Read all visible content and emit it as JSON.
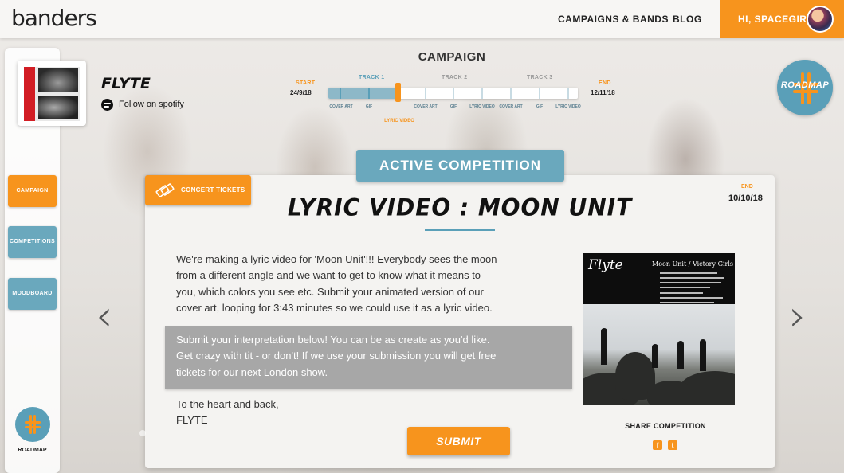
{
  "header": {
    "logo": "banders",
    "nav": [
      "CAMPAIGNS & BANDS",
      "BLOG"
    ],
    "greeting": "HI, SPACEGIRL"
  },
  "sidebar": {
    "items": [
      {
        "label": "CAMPAIGN",
        "active": true
      },
      {
        "label": "COMPETITIONS",
        "active": false
      },
      {
        "label": "MOODBOARD",
        "active": false
      }
    ],
    "roadmap_label": "ROADMAP"
  },
  "band": {
    "name": "FLYTE",
    "spotify_label": "Follow on spotify"
  },
  "campaign": {
    "title": "CAMPAIGN",
    "start_label": "START",
    "start_date": "24/9/18",
    "end_label": "END",
    "end_date": "12/11/18",
    "tracks": [
      "TRACK 1",
      "TRACK 2",
      "TRACK 3"
    ],
    "milestones": [
      "COVER ART",
      "GIF",
      "LYRIC VIDEO",
      "COVER ART",
      "GIF",
      "LYRIC VIDEO",
      "COVER ART",
      "GIF",
      "LYRIC VIDEO"
    ],
    "current_milestone": "LYRIC VIDEO"
  },
  "roadmap_button": "ROADMAP",
  "competition": {
    "banner": "ACTIVE COMPETITION",
    "tag": "CONCERT TICKETS",
    "end_label": "END",
    "end_date": "10/10/18",
    "title": "LYRIC VIDEO : MOON UNIT",
    "paragraph1_lines": [
      "We're making a lyric video for 'Moon Unit'!!! Everybody sees the moon",
      "from a different angle and we want to get to know what it means to",
      "you, which colors you see etc. Submit your animated version of our",
      "cover art, looping for 3:43 minutes so we could use it as a lyric video."
    ],
    "highlight_lines": [
      "Submit your interpretation below! You can be as create as you'd like.",
      "Get crazy with tit - or don't! If we use your submission you will get free",
      "tickets for our next London show."
    ],
    "signoff_lines": [
      "To the heart and back,",
      "FLYTE"
    ],
    "submit_label": "SUBMIT",
    "share_label": "SHARE COMPETITION"
  },
  "cover": {
    "title": "Flyte",
    "subtitle": "Moon Unit / Victory Girls"
  },
  "colors": {
    "accent": "#f7941d",
    "secondary": "#5a9fb8"
  },
  "icons": [
    "spotify-icon",
    "ticket-icon",
    "facebook-icon",
    "twitter-icon",
    "chevron-left-icon",
    "chevron-right-icon"
  ]
}
